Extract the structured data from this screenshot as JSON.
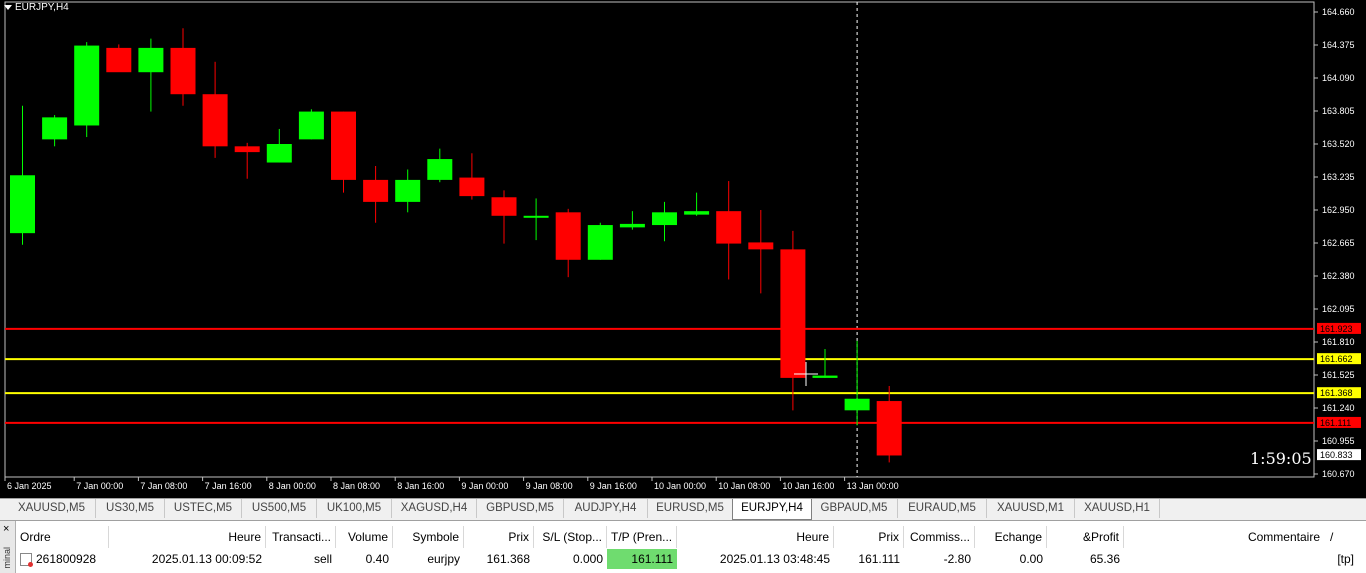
{
  "chart": {
    "title": "EURJPY,H4",
    "timer": "1:59:05",
    "price_axis": [
      "164.660",
      "164.375",
      "164.090",
      "163.805",
      "163.520",
      "163.235",
      "162.950",
      "162.665",
      "162.380",
      "162.095",
      "161.810",
      "161.525",
      "161.240",
      "160.955",
      "160.670"
    ],
    "time_axis": [
      "6 Jan 2025",
      "7 Jan 00:00",
      "7 Jan 08:00",
      "7 Jan 16:00",
      "8 Jan 00:00",
      "8 Jan 08:00",
      "8 Jan 16:00",
      "9 Jan 00:00",
      "9 Jan 08:00",
      "9 Jan 16:00",
      "10 Jan 00:00",
      "10 Jan 08:00",
      "10 Jan 16:00",
      "13 Jan 00:00"
    ],
    "level_lines": [
      {
        "price": 161.923,
        "label": "161.923",
        "color": "#ff0000"
      },
      {
        "price": 161.662,
        "label": "161.662",
        "color": "#ffff00"
      },
      {
        "price": 161.368,
        "label": "161.368",
        "color": "#ffff00"
      },
      {
        "price": 161.111,
        "label": "161.111",
        "color": "#ff0000"
      }
    ],
    "last_price": {
      "price": 160.833,
      "label": "160.833"
    },
    "colors": {
      "bull": "#00ff00",
      "bear": "#ff0000",
      "background": "#000000",
      "foreground": "#ffffff"
    }
  },
  "chart_data": {
    "type": "candlestick",
    "symbol": "EURJPY",
    "timeframe": "H4",
    "ylim": [
      160.67,
      164.66
    ],
    "candles": [
      {
        "o": 162.75,
        "h": 163.85,
        "l": 162.65,
        "c": 163.25
      },
      {
        "o": 163.56,
        "h": 163.77,
        "l": 163.5,
        "c": 163.75
      },
      {
        "o": 163.68,
        "h": 164.4,
        "l": 163.58,
        "c": 164.37
      },
      {
        "o": 164.35,
        "h": 164.38,
        "l": 164.15,
        "c": 164.14
      },
      {
        "o": 164.14,
        "h": 164.43,
        "l": 163.8,
        "c": 164.35
      },
      {
        "o": 164.35,
        "h": 164.52,
        "l": 163.85,
        "c": 163.95
      },
      {
        "o": 163.95,
        "h": 164.23,
        "l": 163.4,
        "c": 163.5
      },
      {
        "o": 163.5,
        "h": 163.53,
        "l": 163.22,
        "c": 163.45
      },
      {
        "o": 163.36,
        "h": 163.65,
        "l": 163.36,
        "c": 163.52
      },
      {
        "o": 163.56,
        "h": 163.82,
        "l": 163.56,
        "c": 163.8
      },
      {
        "o": 163.8,
        "h": 163.8,
        "l": 163.1,
        "c": 163.21
      },
      {
        "o": 163.21,
        "h": 163.33,
        "l": 162.84,
        "c": 163.02
      },
      {
        "o": 163.02,
        "h": 163.3,
        "l": 162.93,
        "c": 163.21
      },
      {
        "o": 163.21,
        "h": 163.48,
        "l": 163.19,
        "c": 163.39
      },
      {
        "o": 163.23,
        "h": 163.44,
        "l": 163.04,
        "c": 163.07
      },
      {
        "o": 163.06,
        "h": 163.12,
        "l": 162.66,
        "c": 162.9
      },
      {
        "o": 162.9,
        "h": 163.05,
        "l": 162.69,
        "c": 162.9
      },
      {
        "o": 162.93,
        "h": 162.96,
        "l": 162.37,
        "c": 162.52
      },
      {
        "o": 162.52,
        "h": 162.84,
        "l": 162.52,
        "c": 162.82
      },
      {
        "o": 162.8,
        "h": 162.94,
        "l": 162.78,
        "c": 162.83
      },
      {
        "o": 162.82,
        "h": 163.02,
        "l": 162.68,
        "c": 162.93
      },
      {
        "o": 162.91,
        "h": 163.1,
        "l": 162.9,
        "c": 162.94
      },
      {
        "o": 162.94,
        "h": 163.2,
        "l": 162.35,
        "c": 162.66
      },
      {
        "o": 162.67,
        "h": 162.95,
        "l": 162.23,
        "c": 162.61
      },
      {
        "o": 162.61,
        "h": 162.77,
        "l": 161.22,
        "c": 161.5
      },
      {
        "o": 161.5,
        "h": 161.75,
        "l": 161.5,
        "c": 161.52
      },
      {
        "o": 161.22,
        "h": 161.82,
        "l": 161.09,
        "c": 161.32
      },
      {
        "o": 161.3,
        "h": 161.43,
        "l": 160.77,
        "c": 160.83
      }
    ]
  },
  "symbol_tabs": [
    "XAUUSD,M5",
    "US30,M5",
    "USTEC,M5",
    "US500,M5",
    "UK100,M5",
    "XAGUSD,H4",
    "GBPUSD,M5",
    "AUDJPY,H4",
    "EURUSD,M5",
    "EURJPY,H4",
    "GBPAUD,M5",
    "EURAUD,M5",
    "XAUUSD,M1",
    "XAUUSD,H1"
  ],
  "active_tab": "EURJPY,H4",
  "terminal": {
    "close_label": "×",
    "side_label": "minal",
    "headers": [
      "Ordre",
      "Heure",
      "Transacti...",
      "Volume",
      "Symbole",
      "Prix",
      "S/L (Stop...",
      "T/P (Pren...",
      "Heure",
      "Prix",
      "Commiss...",
      "Echange",
      "&Profit",
      "Commentaire",
      "/"
    ],
    "row": [
      "261800928",
      "2025.01.13 00:09:52",
      "sell",
      "0.40",
      "eurjpy",
      "161.368",
      "0.000",
      "161.111",
      "2025.01.13 03:48:45",
      "161.111",
      "-2.80",
      "0.00",
      "65.36",
      "[tp]"
    ]
  }
}
